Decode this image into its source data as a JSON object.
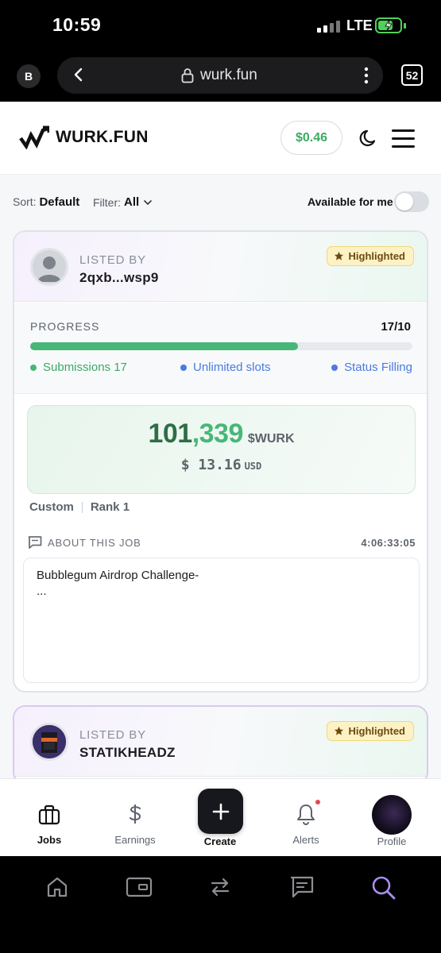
{
  "status_bar": {
    "time": "10:59",
    "network": "LTE",
    "battery_state": "charging"
  },
  "browser": {
    "profile_initial": "B",
    "url": "wurk.fun",
    "tab_count": "52"
  },
  "header": {
    "logo_text": "WURK.FUN",
    "balance": "$0.46"
  },
  "filters": {
    "sort_label": "Sort:",
    "sort_value": "Default",
    "filter_label": "Filter:",
    "filter_value": "All",
    "available_label": "Available for me",
    "available_on": false
  },
  "jobs": [
    {
      "listed_by_label": "LISTED BY",
      "lister": "2qxb...wsp9",
      "badge": "Highlighted",
      "progress_label": "PROGRESS",
      "progress_count": "17/10",
      "progress_fraction": 0.7,
      "stats": {
        "submissions": "Submissions 17",
        "slots": "Unlimited slots",
        "status": "Status Filling"
      },
      "reward_amount": "101,339",
      "reward_unit": "$WURK",
      "reward_usd": "$ 13.16",
      "reward_usd_unit": "USD",
      "tag_type": "Custom",
      "tag_rank": "Rank 1",
      "about_label": "ABOUT THIS JOB",
      "time_left": "4:06:33:05",
      "description": "Bubblegum Airdrop Challenge-\n..."
    },
    {
      "listed_by_label": "LISTED BY",
      "lister": "STATIKHEADZ",
      "badge": "Highlighted"
    }
  ],
  "bottom_nav": {
    "jobs": "Jobs",
    "earnings": "Earnings",
    "create": "Create",
    "alerts": "Alerts",
    "profile": "Profile"
  },
  "colors": {
    "accent_green": "#47b778",
    "badge_yellow": "#fdf2c4",
    "status_blue": "#4a7be0"
  },
  "icons": [
    "lock-icon",
    "back-icon",
    "more-icon",
    "moon-icon",
    "menu-icon",
    "star-icon",
    "chat-icon",
    "briefcase-icon",
    "dollar-icon",
    "plus-icon",
    "bell-icon",
    "home-icon",
    "wallet-icon",
    "swap-icon",
    "message-icon",
    "search-icon"
  ]
}
